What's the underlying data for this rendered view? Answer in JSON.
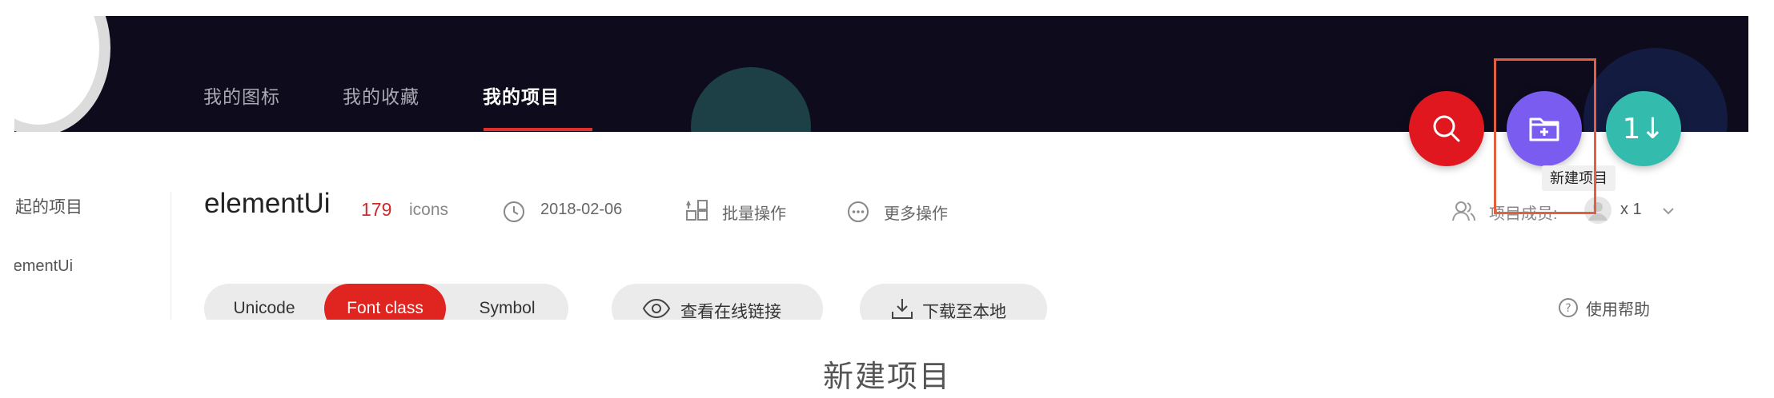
{
  "nav": {
    "items": [
      "我的图标",
      "我的收藏",
      "我的项目"
    ],
    "active_index": 2
  },
  "sidebar": {
    "items": [
      "发起的项目",
      "elementUi"
    ]
  },
  "project": {
    "name": "elementUi",
    "count": "179",
    "count_unit": "icons",
    "date": "2018-02-06",
    "batch_label": "批量操作",
    "more_label": "更多操作",
    "members_label": "项目成员:",
    "members_count": "x 1"
  },
  "toolbar": {
    "segments": [
      "Unicode",
      "Font class",
      "Symbol"
    ],
    "active_segment": "Font class",
    "view_online_label": "查看在线链接",
    "download_label": "下载至本地",
    "help_label": "使用帮助"
  },
  "fabs": {
    "search_color": "#e0171f",
    "new_project_color": "#7b5cf0",
    "sort_color": "#33bcae",
    "sort_label": "1↓",
    "tooltip": "新建项目"
  },
  "colors": {
    "header_bg": "#0e0b1c",
    "accent": "#e0241f",
    "highlight_box": "#e2603f"
  },
  "caption": "新建项目"
}
